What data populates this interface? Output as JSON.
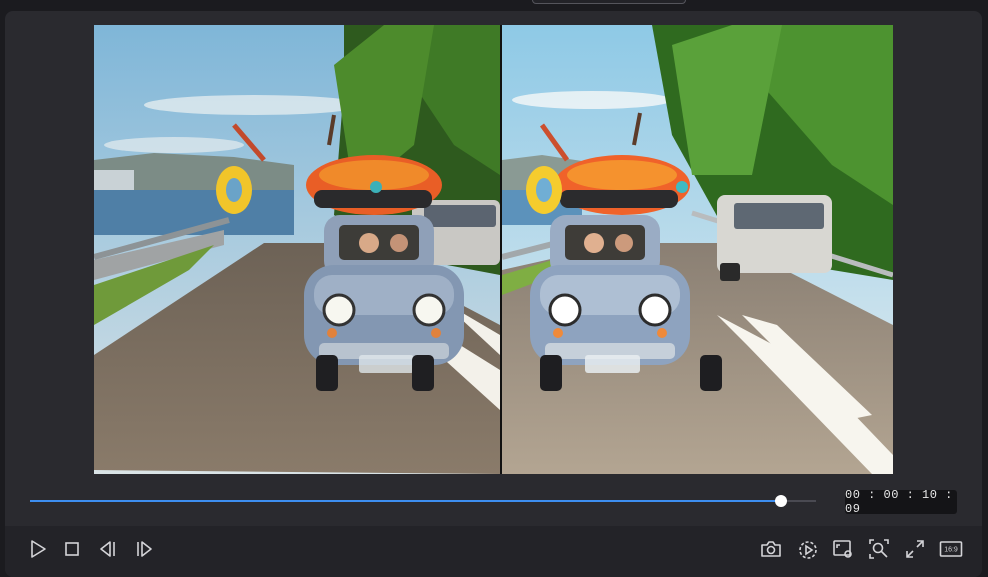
{
  "player": {
    "timecode": "00 : 00 : 10 : 09",
    "progress": 0.955,
    "aspect_ratio_label": "16:9"
  },
  "controls": {
    "left": [
      {
        "name": "play-icon"
      },
      {
        "name": "stop-icon"
      },
      {
        "name": "previous-frame-icon"
      },
      {
        "name": "next-frame-icon"
      }
    ],
    "right": [
      {
        "name": "snapshot-camera-icon"
      },
      {
        "name": "playback-speed-icon"
      },
      {
        "name": "screen-settings-icon"
      },
      {
        "name": "zoom-icon"
      },
      {
        "name": "fullscreen-icon"
      },
      {
        "name": "aspect-ratio-icon"
      }
    ]
  },
  "colors": {
    "accent": "#3d8ef0",
    "panel": "#2a2a2f",
    "background": "#1b1b1f"
  }
}
